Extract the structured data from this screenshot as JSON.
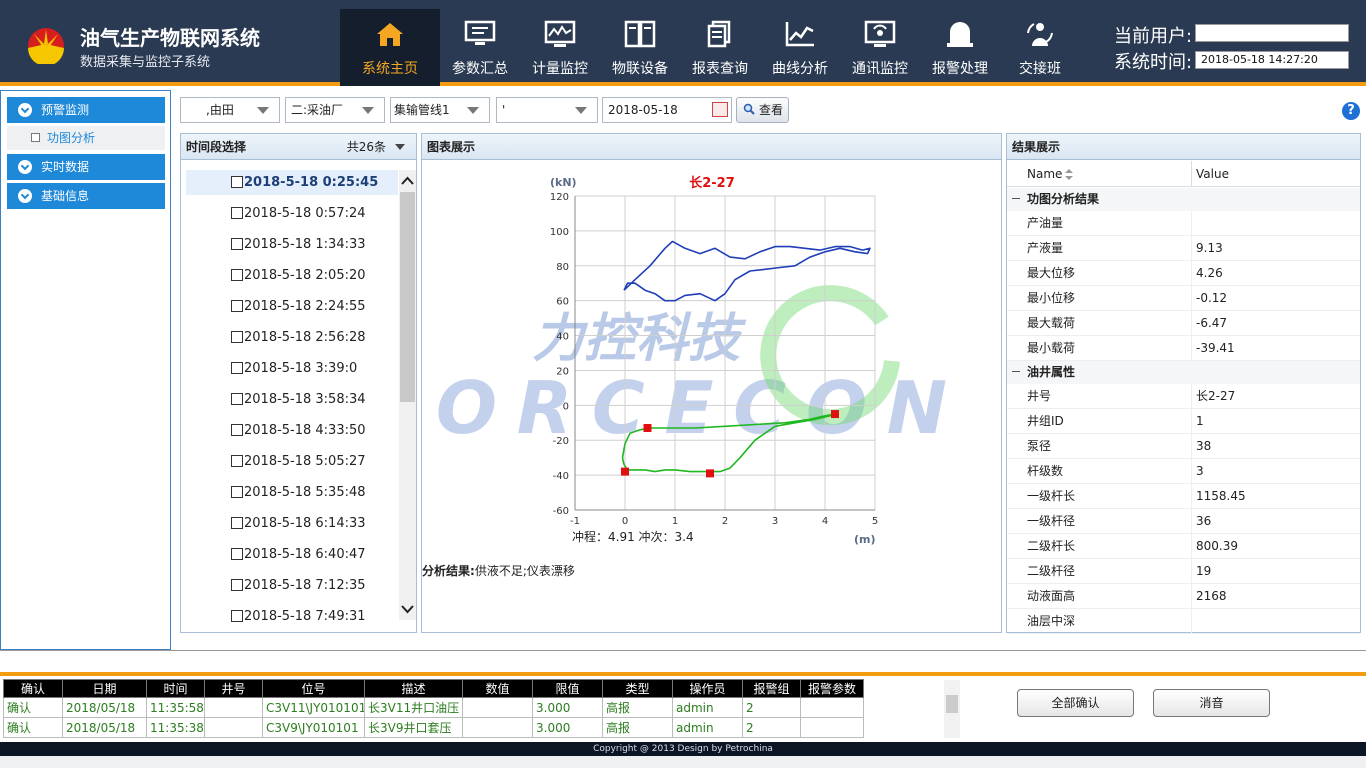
{
  "header": {
    "title": "油气生产物联网系统",
    "subtitle": "数据采集与监控子系统",
    "nav": [
      {
        "label": "系统主页",
        "icon": "home-icon",
        "active": true
      },
      {
        "label": "参数汇总",
        "icon": "monitor-icon"
      },
      {
        "label": "计量监控",
        "icon": "meter-monitor-icon"
      },
      {
        "label": "物联设备",
        "icon": "device-icon"
      },
      {
        "label": "报表查询",
        "icon": "report-icon"
      },
      {
        "label": "曲线分析",
        "icon": "curve-icon"
      },
      {
        "label": "通讯监控",
        "icon": "communication-icon"
      },
      {
        "label": "报警处理",
        "icon": "alarm-icon"
      },
      {
        "label": "交接班",
        "icon": "shift-icon"
      }
    ],
    "user_label": "当前用户:",
    "user_value": "",
    "time_label": "系统时间:",
    "time_value": "2018-05-18 14:27:20"
  },
  "sidebar": {
    "sections": [
      "预警监测",
      "实时数据",
      "基础信息"
    ],
    "sub_item": "功图分析"
  },
  "toolbar": {
    "field1": ",由田",
    "field2": "二:采油厂",
    "field3": "集输管线1",
    "field4": "'",
    "date": "2018-05-18",
    "search_label": "查看"
  },
  "time_panel": {
    "title": "时间段选择",
    "count": "共26条",
    "items": [
      "2018-5-18 0:25:45",
      "2018-5-18 0:57:24",
      "2018-5-18 1:34:33",
      "2018-5-18 2:05:20",
      "2018-5-18 2:24:55",
      "2018-5-18 2:56:28",
      "2018-5-18 3:39:0",
      "2018-5-18 3:58:34",
      "2018-5-18 4:33:50",
      "2018-5-18 5:05:27",
      "2018-5-18 5:35:48",
      "2018-5-18 6:14:33",
      "2018-5-18 6:40:47",
      "2018-5-18 7:12:35",
      "2018-5-18 7:49:31"
    ]
  },
  "chart_panel": {
    "title": "图表展示",
    "analysis_label": "分析结果:",
    "analysis_value": "供液不足;仪表漂移"
  },
  "chart_data": {
    "type": "line",
    "title": "长2-27",
    "xlabel": "(m)",
    "ylabel": "(kN)",
    "xlim": [
      -1,
      5
    ],
    "ylim": [
      -60,
      120
    ],
    "xticks": [
      -1,
      0,
      1,
      2,
      3,
      4,
      5
    ],
    "yticks": [
      -60,
      -40,
      -20,
      0,
      20,
      40,
      60,
      80,
      100,
      120
    ],
    "grid": true,
    "footer_text": "冲程：4.91 冲次：3.4",
    "watermark_cn": "力控科技",
    "watermark_en": "FORCECON",
    "series": [
      {
        "color": "#1f3eb8",
        "x": [
          -0.02,
          0.2,
          0.5,
          0.8,
          0.95,
          1.2,
          1.5,
          1.8,
          2.1,
          2.4,
          2.7,
          3.0,
          3.3,
          3.6,
          3.9,
          4.2,
          4.5,
          4.75,
          4.9,
          4.85,
          4.6,
          4.3,
          4.0,
          3.7,
          3.4,
          3.1,
          2.8,
          2.5,
          2.2,
          2.0,
          1.8,
          1.5,
          1.2,
          1.0,
          0.8,
          0.6,
          0.4,
          0.2,
          0.05,
          -0.02
        ],
        "y": [
          66,
          72,
          80,
          90,
          94,
          90,
          87,
          90,
          85,
          84,
          88,
          91,
          91,
          90,
          89,
          91,
          91,
          89,
          90,
          87,
          88,
          90,
          88,
          85,
          80,
          79,
          78,
          77,
          72,
          64,
          60,
          64,
          63,
          60,
          60,
          64,
          66,
          70,
          70,
          66
        ]
      },
      {
        "color": "#1fb81f",
        "x": [
          -0.02,
          -0.05,
          0.0,
          0.1,
          0.3,
          0.5,
          0.9,
          1.4,
          2.0,
          2.6,
          3.2,
          3.7,
          4.0,
          4.2,
          4.1,
          3.8,
          3.4,
          3.0,
          2.6,
          2.3,
          2.1,
          1.9,
          1.7,
          1.5,
          1.3,
          1.0,
          0.8,
          0.6,
          0.4,
          0.2,
          0.05,
          -0.02
        ],
        "y": [
          -34,
          -30,
          -22,
          -16,
          -14,
          -13,
          -13,
          -13,
          -12,
          -11,
          -10,
          -8,
          -6,
          -5,
          -6,
          -8,
          -10,
          -12,
          -20,
          -30,
          -36,
          -38,
          -38,
          -38,
          -38,
          -37,
          -37,
          -38,
          -37,
          -37,
          -37,
          -34
        ]
      }
    ],
    "markers": {
      "color": "#e01010",
      "x": [
        0.45,
        4.2,
        1.7,
        0.0
      ],
      "y": [
        -13,
        -5,
        -39,
        -38
      ]
    }
  },
  "result_panel": {
    "title": "结果展示",
    "col_name": "Name",
    "col_value": "Value",
    "groups": [
      {
        "label": "功图分析结果",
        "rows": [
          {
            "name": "产油量",
            "value": ""
          },
          {
            "name": "产液量",
            "value": "9.13"
          },
          {
            "name": "最大位移",
            "value": "4.26"
          },
          {
            "name": "最小位移",
            "value": "-0.12"
          },
          {
            "name": "最大载荷",
            "value": "-6.47"
          },
          {
            "name": "最小载荷",
            "value": "-39.41"
          }
        ]
      },
      {
        "label": "油井属性",
        "rows": [
          {
            "name": "井号",
            "value": "长2-27"
          },
          {
            "name": "井组ID",
            "value": "1"
          },
          {
            "name": "泵径",
            "value": "38"
          },
          {
            "name": "杆级数",
            "value": "3"
          },
          {
            "name": "一级杆长",
            "value": "1158.45"
          },
          {
            "name": "一级杆径",
            "value": "36"
          },
          {
            "name": "二级杆长",
            "value": "800.39"
          },
          {
            "name": "二级杆径",
            "value": "19"
          },
          {
            "name": "动液面高",
            "value": "2168"
          },
          {
            "name": "油层中深",
            "value": ""
          }
        ]
      }
    ]
  },
  "alarm": {
    "columns": [
      "确认",
      "日期",
      "时间",
      "井号",
      "位号",
      "描述",
      "数值",
      "限值",
      "类型",
      "操作员",
      "报警组",
      "报警参数"
    ],
    "rows": [
      [
        "确认",
        "2018/05/18",
        "11:35:58",
        "",
        "C3V11\\JY010101",
        "长3V11井口油压",
        "",
        "3.000",
        "高报",
        "admin",
        "2",
        ""
      ],
      [
        "确认",
        "2018/05/18",
        "11:35:38",
        "",
        "C3V9\\JY010101",
        "长3V9井口套压",
        "",
        "3.000",
        "高报",
        "admin",
        "2",
        ""
      ]
    ],
    "confirm_all": "全部确认",
    "mute": "消音"
  },
  "footer": "Copyright @ 2013 Design by Petrochina"
}
